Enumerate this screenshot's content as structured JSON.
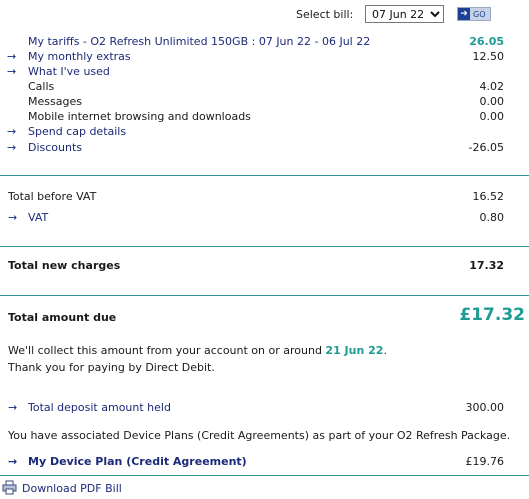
{
  "header": {
    "select_bill_label": "Select bill:",
    "bill_options": [
      "07 Jun 22"
    ],
    "selected_bill": "07 Jun 22",
    "go_label": "GO"
  },
  "lines": {
    "tariffs": {
      "label": "My tariffs - O2 Refresh Unlimited 150GB : 07 Jun 22 - 06 Jul 22",
      "value": "26.05"
    },
    "extras": {
      "label": "My monthly extras",
      "value": "12.50"
    },
    "used": {
      "label": "What I've used"
    },
    "calls": {
      "label": "Calls",
      "value": "4.02"
    },
    "messages": {
      "label": "Messages",
      "value": "0.00"
    },
    "mobile": {
      "label": "Mobile internet browsing and downloads",
      "value": "0.00"
    },
    "spendcap": {
      "label": "Spend cap details"
    },
    "discounts": {
      "label": "Discounts",
      "value": "-26.05"
    }
  },
  "totals": {
    "before_vat": {
      "label": "Total before VAT",
      "value": "16.52"
    },
    "vat": {
      "label": "VAT",
      "value": "0.80"
    },
    "new_charges": {
      "label": "Total new charges",
      "value": "17.32"
    },
    "amount_due": {
      "label": "Total amount due",
      "value": "£17.32"
    }
  },
  "collect": {
    "text_before": "We'll collect this amount from your account on or around ",
    "date": "21 Jun 22",
    "text_after": ".",
    "thanks": "Thank you for paying by Direct Debit."
  },
  "deposit": {
    "label": "Total deposit amount held",
    "value": "300.00"
  },
  "device": {
    "note": "You have associated Device Plans (Credit Agreements) as part of your O2 Refresh Package.",
    "plan_label": "My Device Plan (Credit Agreement)",
    "plan_value": "£19.76"
  },
  "pdf": {
    "label": "Download PDF Bill"
  },
  "colors": {
    "navy": "#1b2a78",
    "teal": "#1e9c93",
    "rule": "#2f8f96"
  }
}
